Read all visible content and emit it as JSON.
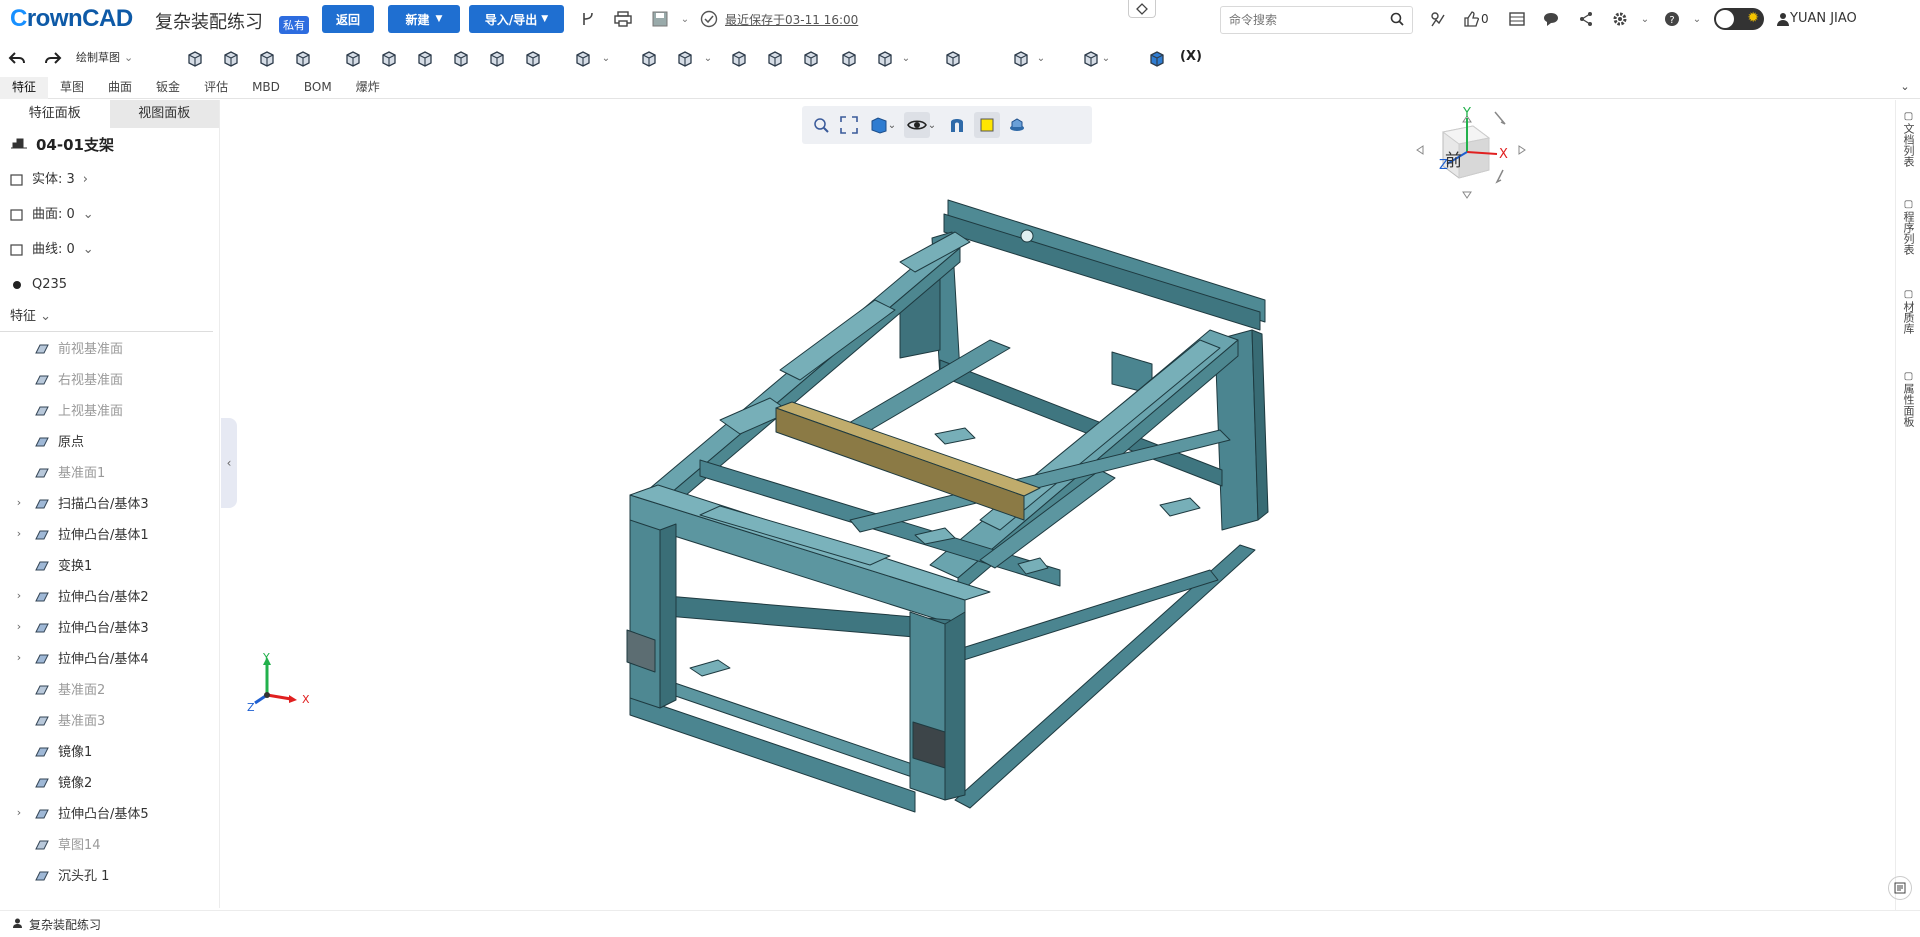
{
  "app": {
    "logo_c": "C",
    "logo_rest": "rownCAD",
    "doc_title": "复杂装配练习",
    "private_badge": "私有"
  },
  "header": {
    "back_label": "返回",
    "new_label": "新建",
    "import_export_label": "导入/导出",
    "saved_text": "最近保存于03-11 16:00",
    "search_placeholder": "命令搜索",
    "like_count": "0",
    "user_name": "YUAN JIAO"
  },
  "toolbar": {
    "undo": "undo-icon",
    "redo": "redo-icon",
    "sketch_select": "绘制草图",
    "formula_label": "(X)"
  },
  "tabs": [
    "特征",
    "草图",
    "曲面",
    "钣金",
    "评估",
    "MBD",
    "BOM",
    "爆炸"
  ],
  "sidebar": {
    "tabs": [
      "特征面板",
      "视图面板"
    ],
    "part_name": "04-01支架",
    "summary": [
      {
        "label": "实体: 3",
        "suffix": "›"
      },
      {
        "label": "曲面: 0",
        "suffix": "⌄"
      },
      {
        "label": "曲线: 0",
        "suffix": "⌄"
      },
      {
        "label": "Q235",
        "suffix": ""
      }
    ],
    "feature_header": "特征",
    "features": [
      {
        "label": "前视基准面",
        "gray": true,
        "expand": false
      },
      {
        "label": "右视基准面",
        "gray": true,
        "expand": false
      },
      {
        "label": "上视基准面",
        "gray": true,
        "expand": false
      },
      {
        "label": "原点",
        "gray": false,
        "expand": false
      },
      {
        "label": "基准面1",
        "gray": true,
        "expand": false
      },
      {
        "label": "扫描凸台/基体3",
        "gray": false,
        "expand": true
      },
      {
        "label": "拉伸凸台/基体1",
        "gray": false,
        "expand": true
      },
      {
        "label": "变换1",
        "gray": false,
        "expand": false
      },
      {
        "label": "拉伸凸台/基体2",
        "gray": false,
        "expand": true
      },
      {
        "label": "拉伸凸台/基体3",
        "gray": false,
        "expand": true
      },
      {
        "label": "拉伸凸台/基体4",
        "gray": false,
        "expand": true
      },
      {
        "label": "基准面2",
        "gray": true,
        "expand": false
      },
      {
        "label": "基准面3",
        "gray": true,
        "expand": false
      },
      {
        "label": "镜像1",
        "gray": false,
        "expand": false
      },
      {
        "label": "镜像2",
        "gray": false,
        "expand": false
      },
      {
        "label": "拉伸凸台/基体5",
        "gray": false,
        "expand": true
      },
      {
        "label": "草图14",
        "gray": true,
        "expand": false
      },
      {
        "label": "沉头孔 1",
        "gray": false,
        "expand": false
      }
    ]
  },
  "right_panel": [
    "文档列表",
    "程序列表",
    "材质库",
    "属性面板"
  ],
  "viewcube": {
    "face_label": "前",
    "x": "X",
    "y": "Y",
    "z": "Z"
  },
  "triad": {
    "x": "X",
    "y": "Y",
    "z": "Z"
  },
  "statusbar": {
    "doc_name": "复杂装配练习"
  },
  "colors": {
    "accent": "#1f6fd1",
    "frame": "#4e8590",
    "beam": "#8b7a45"
  }
}
